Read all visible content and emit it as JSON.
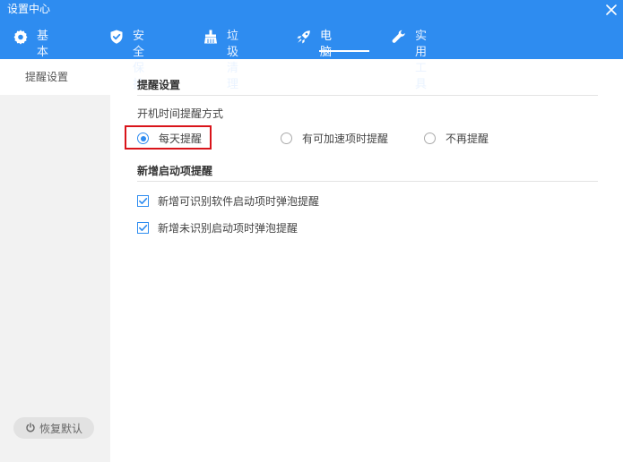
{
  "window": {
    "title": "设置中心"
  },
  "tabs": [
    {
      "label": "基本设置",
      "icon": "gear-icon"
    },
    {
      "label": "安全保护",
      "icon": "shield-check-icon"
    },
    {
      "label": "垃圾清理",
      "icon": "broom-icon"
    },
    {
      "label": "电脑加速",
      "icon": "rocket-icon",
      "active": true
    },
    {
      "label": "实用工具",
      "icon": "wrench-icon"
    }
  ],
  "sidebar": {
    "items": [
      {
        "label": "提醒设置",
        "active": true
      }
    ],
    "restore_label": "恢复默认"
  },
  "main": {
    "section1": {
      "title": "提醒设置",
      "group_label": "开机时间提醒方式",
      "options": [
        {
          "label": "每天提醒",
          "checked": true
        },
        {
          "label": "有可加速项时提醒",
          "checked": false
        },
        {
          "label": "不再提醒",
          "checked": false
        }
      ]
    },
    "section2": {
      "title": "新增启动项提醒",
      "checks": [
        {
          "label": "新增可识别软件启动项时弹泡提醒",
          "checked": true
        },
        {
          "label": "新增未识别启动项时弹泡提醒",
          "checked": true
        }
      ]
    }
  },
  "colors": {
    "accent": "#2e8cf0",
    "highlight": "#d9141a",
    "sidebar_bg": "#f2f2f2"
  }
}
